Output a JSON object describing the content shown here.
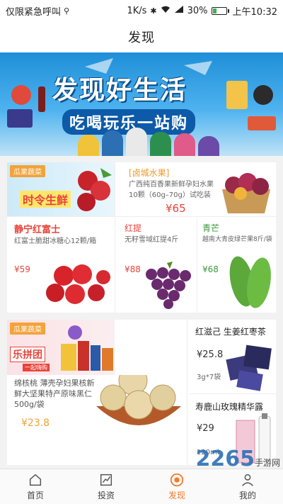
{
  "status": {
    "carrier": "仅限紧急呼叫",
    "speed": "1K/s",
    "battery": "30%",
    "time": "上午10:32",
    "battery_level": 0.3
  },
  "header": {
    "title": "发现"
  },
  "banner": {
    "title": "发现好生活",
    "subtitle": "吃喝玩乐一站购"
  },
  "section1": {
    "promo": {
      "tag": "瓜果蔬菜",
      "title": "时令生鲜"
    },
    "item1": {
      "tag": "[卤城水果]",
      "desc": "广西纯百香果新鲜孕妇水果10颗（60g–70g）试吃装",
      "price": "¥65"
    },
    "item2": {
      "name": "静宁红富士",
      "desc": "红富士脆甜冰糖心12颗/箱",
      "price": "¥59"
    },
    "item3": {
      "name": "红提",
      "desc": "无籽雪域红提4斤",
      "price": "¥88"
    },
    "item4": {
      "name": "青芒",
      "desc": "越南大青皮绿芒果8斤/袋",
      "price": "¥68"
    }
  },
  "section2": {
    "promo": {
      "tag": "瓜果蔬菜",
      "title": "乐拼团",
      "badge": "一起嗨购"
    },
    "main_item": {
      "desc": "绵核桃 薄壳孕妇果核新鲜大坚果特产原味黑仁 500g/袋",
      "price": "¥23.8"
    },
    "item1": {
      "name": "红滋己 生姜红枣茶",
      "price": "¥25.8",
      "spec": "3g*7袋"
    },
    "item2": {
      "name": "寿鹿山玫瑰精华露",
      "price": "¥29",
      "spec": "120ml"
    }
  },
  "tabbar": {
    "tabs": [
      {
        "label": "首页",
        "icon": "home-icon"
      },
      {
        "label": "投资",
        "icon": "chart-icon"
      },
      {
        "label": "发现",
        "icon": "discover-icon"
      },
      {
        "label": "我的",
        "icon": "user-icon"
      }
    ]
  },
  "watermark": {
    "text": "2265",
    "sub": "手游网"
  }
}
